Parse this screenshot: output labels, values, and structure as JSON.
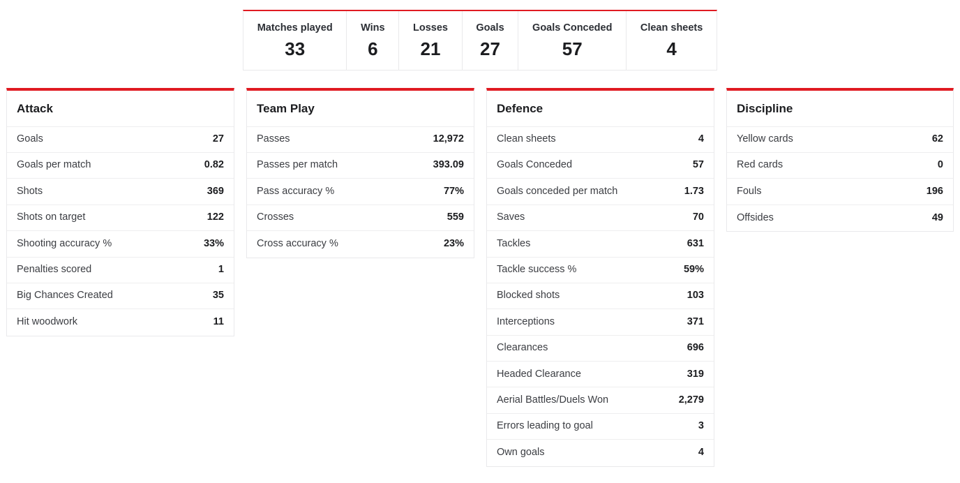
{
  "summary": {
    "items": [
      {
        "label": "Matches played",
        "value": "33"
      },
      {
        "label": "Wins",
        "value": "6"
      },
      {
        "label": "Losses",
        "value": "21"
      },
      {
        "label": "Goals",
        "value": "27"
      },
      {
        "label": "Goals Conceded",
        "value": "57"
      },
      {
        "label": "Clean sheets",
        "value": "4"
      }
    ]
  },
  "cards": [
    {
      "title": "Attack",
      "rows": [
        {
          "label": "Goals",
          "value": "27"
        },
        {
          "label": "Goals per match",
          "value": "0.82"
        },
        {
          "label": "Shots",
          "value": "369"
        },
        {
          "label": "Shots on target",
          "value": "122"
        },
        {
          "label": "Shooting accuracy %",
          "value": "33%"
        },
        {
          "label": "Penalties scored",
          "value": "1"
        },
        {
          "label": "Big Chances Created",
          "value": "35"
        },
        {
          "label": "Hit woodwork",
          "value": "11"
        }
      ]
    },
    {
      "title": "Team Play",
      "rows": [
        {
          "label": "Passes",
          "value": "12,972"
        },
        {
          "label": "Passes per match",
          "value": "393.09"
        },
        {
          "label": "Pass accuracy %",
          "value": "77%"
        },
        {
          "label": "Crosses",
          "value": "559"
        },
        {
          "label": "Cross accuracy %",
          "value": "23%"
        }
      ]
    },
    {
      "title": "Defence",
      "rows": [
        {
          "label": "Clean sheets",
          "value": "4"
        },
        {
          "label": "Goals Conceded",
          "value": "57"
        },
        {
          "label": "Goals conceded per match",
          "value": "1.73"
        },
        {
          "label": "Saves",
          "value": "70"
        },
        {
          "label": "Tackles",
          "value": "631"
        },
        {
          "label": "Tackle success %",
          "value": "59%"
        },
        {
          "label": "Blocked shots",
          "value": "103"
        },
        {
          "label": "Interceptions",
          "value": "371"
        },
        {
          "label": "Clearances",
          "value": "696"
        },
        {
          "label": "Headed Clearance",
          "value": "319"
        },
        {
          "label": "Aerial Battles/Duels Won",
          "value": "2,279"
        },
        {
          "label": "Errors leading to goal",
          "value": "3"
        },
        {
          "label": "Own goals",
          "value": "4"
        }
      ]
    },
    {
      "title": "Discipline",
      "rows": [
        {
          "label": "Yellow cards",
          "value": "62"
        },
        {
          "label": "Red cards",
          "value": "0"
        },
        {
          "label": "Fouls",
          "value": "196"
        },
        {
          "label": "Offsides",
          "value": "49"
        }
      ]
    }
  ],
  "theme": {
    "accent": "#e01b22",
    "border": "#e9e9eb",
    "row_divider": "#eeeeef",
    "label_color": "#3b3d42",
    "value_color": "#1c1d20",
    "background": "#ffffff"
  }
}
